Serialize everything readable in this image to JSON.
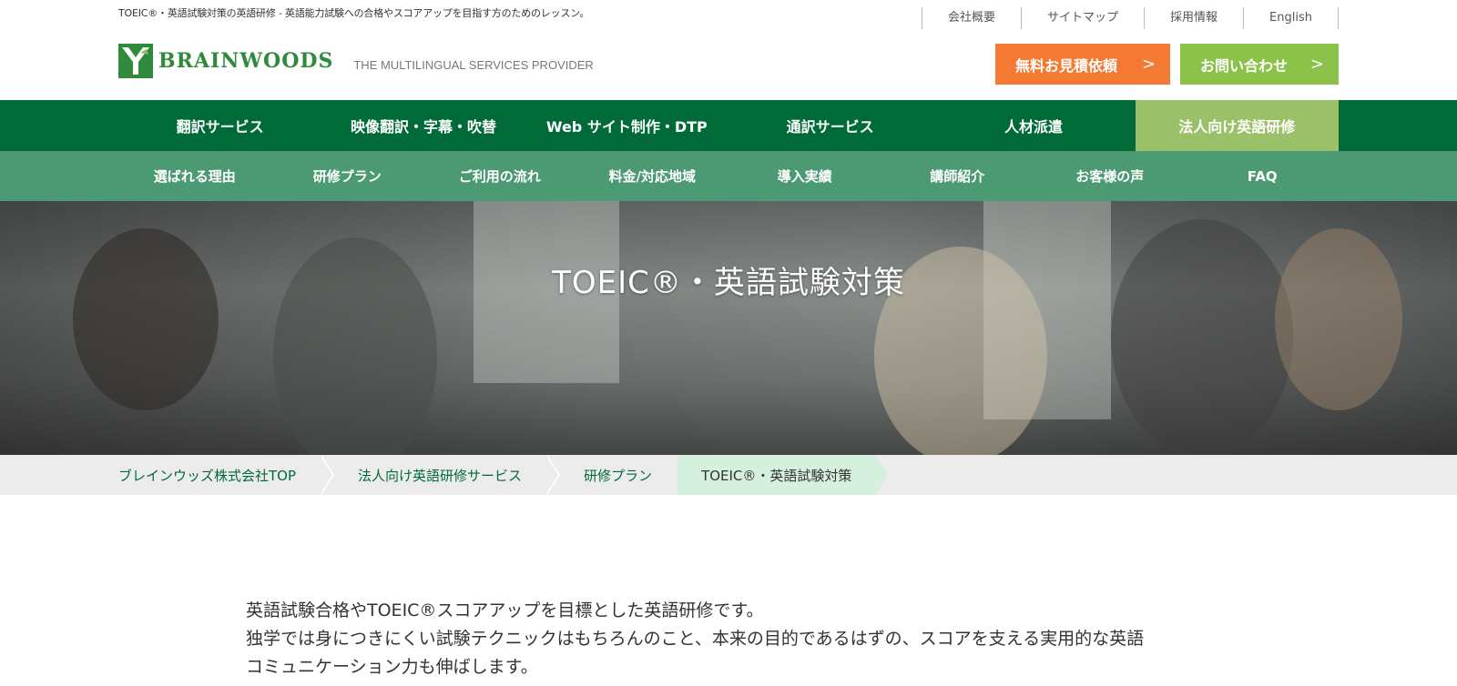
{
  "header": {
    "tagline": "TOEIC®・英語試験対策の英語研修 - 英語能力試験への合格やスコアアップを目指す方のためのレッスン。",
    "util_nav": [
      "会社概要",
      "サイトマップ",
      "採用情報",
      "English"
    ],
    "logo_text": "BRAINWOODS",
    "logo_sub": "THE MULTILINGUAL SERVICES PROVIDER",
    "cta_quote": "無料お見積依頼",
    "cta_contact": "お問い合わせ",
    "arrow": ">"
  },
  "main_nav": [
    "翻訳サービス",
    "映像翻訳・字幕・吹替",
    "Web サイト制作・DTP",
    "通訳サービス",
    "人材派遣",
    "法人向け英語研修"
  ],
  "sub_nav": [
    "選ばれる理由",
    "研修プラン",
    "ご利用の流れ",
    "料金/対応地域",
    "導入実績",
    "講師紹介",
    "お客様の声",
    "FAQ"
  ],
  "hero": {
    "title": "TOEIC®・英語試験対策"
  },
  "breadcrumb": [
    "ブレインウッズ株式会社TOP",
    "法人向け英語研修サービス",
    "研修プラン",
    "TOEIC®・英語試験対策"
  ],
  "intro": {
    "line1": "英語試験合格やTOEIC®スコアアップを目標とした英語研修です。",
    "line2": "独学では身につきにくい試験テクニックはもちろんのこと、本来の目的であるはずの、スコアを支える実用的な英語",
    "line3": "コミュニケーション力も伸ばします。"
  },
  "colors": {
    "brand_green": "#006b38",
    "sub_nav_green": "#4c9a73",
    "active_nav": "#9bc06a",
    "cta_orange": "#f47a33",
    "cta_green": "#8bc34a"
  }
}
